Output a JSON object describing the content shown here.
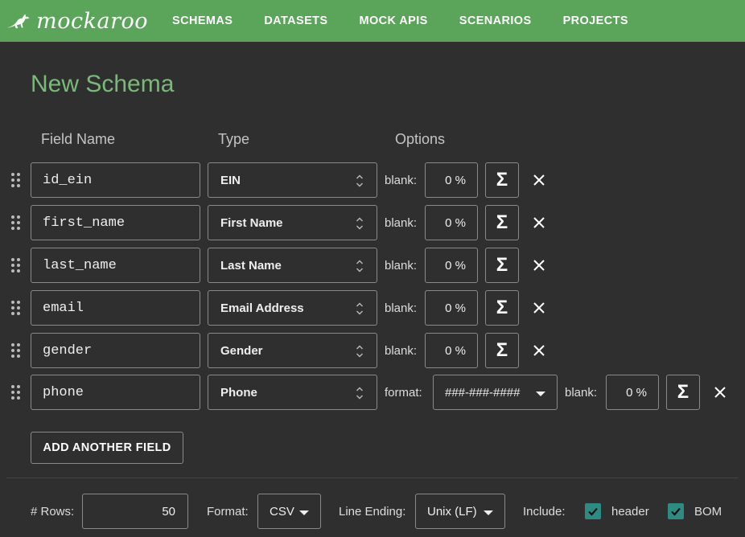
{
  "brand": {
    "name": "mockaroo",
    "color": "#5aa55a"
  },
  "nav": [
    {
      "label": "SCHEMAS"
    },
    {
      "label": "DATASETS"
    },
    {
      "label": "MOCK APIS"
    },
    {
      "label": "SCENARIOS"
    },
    {
      "label": "PROJECTS"
    }
  ],
  "page_title": "New Schema",
  "columns": {
    "field_name": "Field Name",
    "type": "Type",
    "options": "Options"
  },
  "fields": [
    {
      "name": "id_ein",
      "type": "EIN",
      "blank_label": "blank:",
      "blank": "0 %"
    },
    {
      "name": "first_name",
      "type": "First Name",
      "blank_label": "blank:",
      "blank": "0 %"
    },
    {
      "name": "last_name",
      "type": "Last Name",
      "blank_label": "blank:",
      "blank": "0 %"
    },
    {
      "name": "email",
      "type": "Email Address",
      "blank_label": "blank:",
      "blank": "0 %"
    },
    {
      "name": "gender",
      "type": "Gender",
      "blank_label": "blank:",
      "blank": "0 %"
    },
    {
      "name": "phone",
      "type": "Phone",
      "format_label": "format:",
      "format": "###-###-####",
      "blank_label": "blank:",
      "blank": "0 %"
    }
  ],
  "sigma_glyph": "Σ",
  "add_field_label": "ADD ANOTHER FIELD",
  "footer": {
    "rows_label": "# Rows:",
    "rows_value": "50",
    "format_label": "Format:",
    "format_value": "CSV",
    "line_ending_label": "Line Ending:",
    "line_ending_value": "Unix (LF)",
    "include_label": "Include:",
    "header_label": "header",
    "header_checked": true,
    "bom_label": "BOM",
    "bom_checked": true
  },
  "colors": {
    "background": "#2f2f2f",
    "title": "#79b979",
    "checkbox": "#2e8b82"
  }
}
